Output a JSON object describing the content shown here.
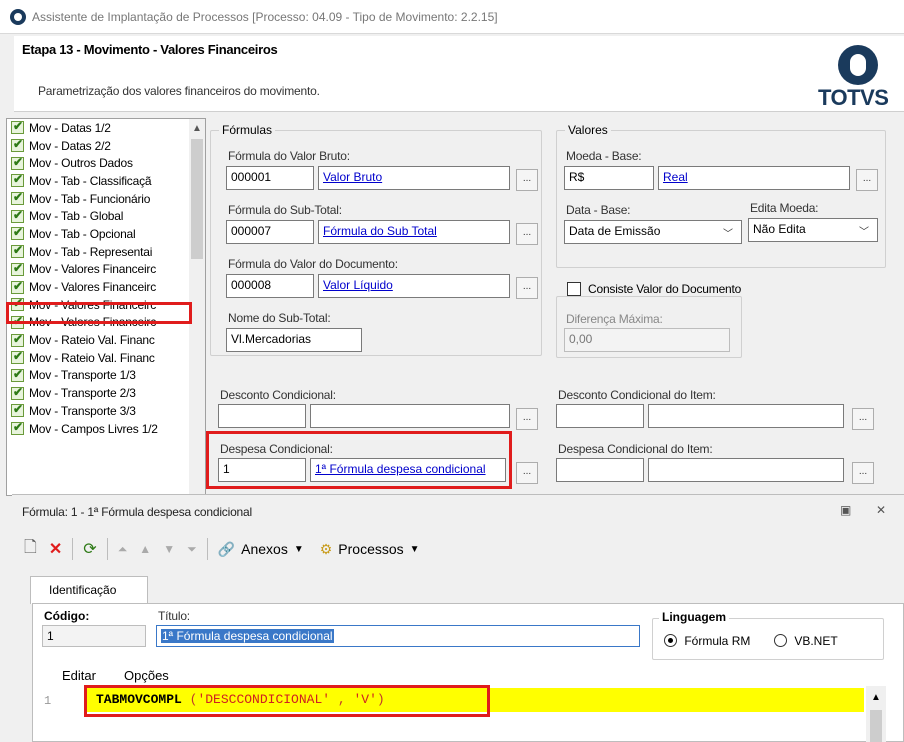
{
  "window": {
    "title": "Assistente de Implantação de Processos [Processo: 04.09 - Tipo de Movimento: 2.2.15]"
  },
  "header": {
    "step_title": "Etapa 13 - Movimento - Valores Financeiros",
    "description": "Parametrização dos valores financeiros do movimento.",
    "logo_text": "TOTVS"
  },
  "steps": [
    "Mov - Datas 1/2",
    "Mov - Datas 2/2",
    "Mov - Outros Dados",
    "Mov - Tab - Classificaçã",
    "Mov - Tab - Funcionário",
    "Mov - Tab - Global",
    "Mov - Tab - Opcional",
    "Mov - Tab - Representai",
    "Mov - Valores Financeirc",
    "Mov - Valores Financeirc",
    "Mov - Valores Financeirc",
    "Mov - Valores Financeirc",
    "Mov - Rateio Val. Financ",
    "Mov - Rateio Val. Financ",
    "Mov - Transporte 1/3",
    "Mov - Transporte 2/3",
    "Mov - Transporte 3/3",
    "Mov - Campos Livres 1/2"
  ],
  "formulas": {
    "group_title": "Fórmulas",
    "bruto_label": "Fórmula do Valor Bruto:",
    "bruto_code": "000001",
    "bruto_desc": "Valor Bruto",
    "subtotal_label": "Fórmula do Sub-Total:",
    "subtotal_code": "000007",
    "subtotal_desc": "Fórmula do Sub Total",
    "documento_label": "Fórmula do Valor do Documento:",
    "documento_code": "000008",
    "documento_desc": "Valor Líquido",
    "nome_subtotal_label": "Nome do Sub-Total:",
    "nome_subtotal_value": "Vl.Mercadorias",
    "dots": "..."
  },
  "valores": {
    "group_title": "Valores",
    "moeda_label": "Moeda - Base:",
    "moeda_code": "R$",
    "moeda_desc": "Real",
    "data_label": "Data - Base:",
    "data_value": "Data de Emissão",
    "edita_label": "Edita Moeda:",
    "edita_value": "Não Edita",
    "consiste_label": "Consiste Valor do Documento",
    "diferenca_label": "Diferença Máxima:",
    "diferenca_value": "0,00"
  },
  "condicional": {
    "desconto_label": "Desconto Condicional:",
    "desconto_item_label": "Desconto Condicional do Item:",
    "despesa_label": "Despesa Condicional:",
    "despesa_code": "1",
    "despesa_desc": "1ª Fórmula despesa condicional",
    "despesa_item_label": "Despesa Condicional do Item:"
  },
  "formula_window": {
    "title": "Fórmula: 1 - 1ª Fórmula despesa condicional",
    "toolbar": {
      "anexos": "Anexos",
      "processos": "Processos"
    },
    "tab_label": "Identificação",
    "codigo_label": "Código:",
    "codigo_value": "1",
    "titulo_label": "Título:",
    "titulo_value": "1ª Fórmula despesa condicional",
    "linguagem_label": "Linguagem",
    "opt_rm": "Fórmula RM",
    "opt_vb": "VB.NET",
    "menu_editar": "Editar",
    "menu_opcoes": "Opções",
    "line_number": "1",
    "code_func": "TABMOVCOMPL",
    "code_open": " (",
    "code_arg1": "'DESCCONDICIONAL'",
    "code_sep": " , ",
    "code_arg2": "'V'",
    "code_close": ")"
  },
  "colors": {
    "highlight_red": "#e01c1c",
    "link_blue": "#0000cc",
    "code_yellow": "#ffff00",
    "brand": "#1a3a5c"
  }
}
